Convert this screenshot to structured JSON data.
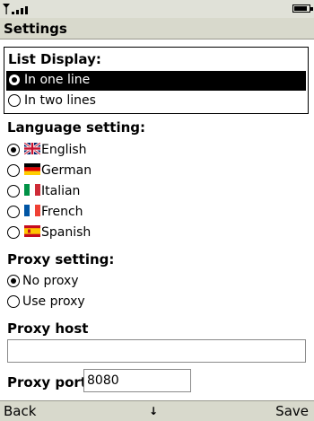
{
  "status_bar": {
    "signal_icon": "signal-strength-icon",
    "battery_icon": "battery-icon"
  },
  "title": "Settings",
  "list_display": {
    "heading": "List Display:",
    "options": [
      "In one line",
      "In two lines"
    ],
    "selected_index": 0
  },
  "language": {
    "heading": "Language setting:",
    "options": [
      {
        "label": "English",
        "flag": "uk-flag-icon"
      },
      {
        "label": "German",
        "flag": "germany-flag-icon"
      },
      {
        "label": "Italian",
        "flag": "italy-flag-icon"
      },
      {
        "label": "French",
        "flag": "france-flag-icon"
      },
      {
        "label": "Spanish",
        "flag": "spain-flag-icon"
      }
    ],
    "selected_index": 0
  },
  "proxy": {
    "heading": "Proxy setting:",
    "options": [
      "No proxy",
      "Use proxy"
    ],
    "selected_index": 0
  },
  "proxy_host": {
    "label": "Proxy host",
    "value": ""
  },
  "proxy_port": {
    "label": "Proxy port",
    "value": "8080"
  },
  "softkeys": {
    "left": "Back",
    "right": "Save",
    "center_icon": "scroll-down-arrow-icon"
  }
}
